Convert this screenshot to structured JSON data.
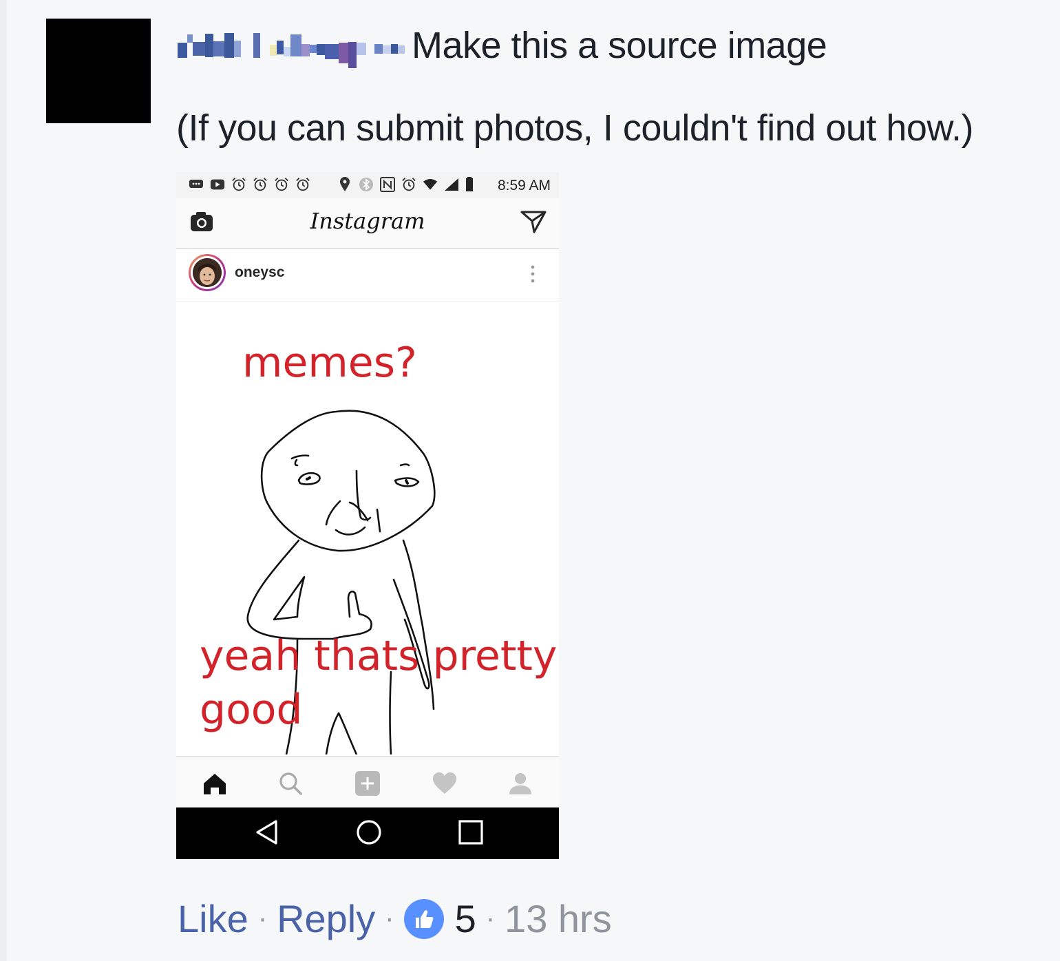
{
  "comment": {
    "author_redacted": "pixelated-name",
    "line1": "Make this a source image",
    "line2": "(If you can submit photos, I couldn't find out how.)"
  },
  "phone": {
    "status_time": "8:59 AM",
    "app_title": "Instagram",
    "post_username": "oneysc",
    "post_caption_top": "memes?",
    "post_caption_bottom_1": "yeah thats pretty",
    "post_caption_bottom_2": "good",
    "icons": {
      "status": [
        "message-icon",
        "youtube-icon",
        "alarm-icon",
        "alarm-icon",
        "alarm-icon",
        "alarm-icon",
        "location-icon",
        "bluetooth-icon",
        "nfc-icon",
        "clock-icon",
        "wifi-icon",
        "signal-icon",
        "battery-icon"
      ],
      "header": [
        "camera-icon",
        "direct-message-icon"
      ],
      "bottom_nav": [
        "home-icon",
        "search-icon",
        "add-post-icon",
        "heart-icon",
        "profile-icon"
      ],
      "android_nav": [
        "back-icon",
        "home-circle-icon",
        "recents-icon"
      ]
    }
  },
  "actions": {
    "like": "Like",
    "reply": "Reply",
    "like_count": "5",
    "timestamp": "13 hrs"
  },
  "colors": {
    "background": "#f6f7f9",
    "link": "#4a63a8",
    "meta": "#90949c",
    "caption_red": "#d2232a",
    "like_badge": "#5890ff"
  }
}
